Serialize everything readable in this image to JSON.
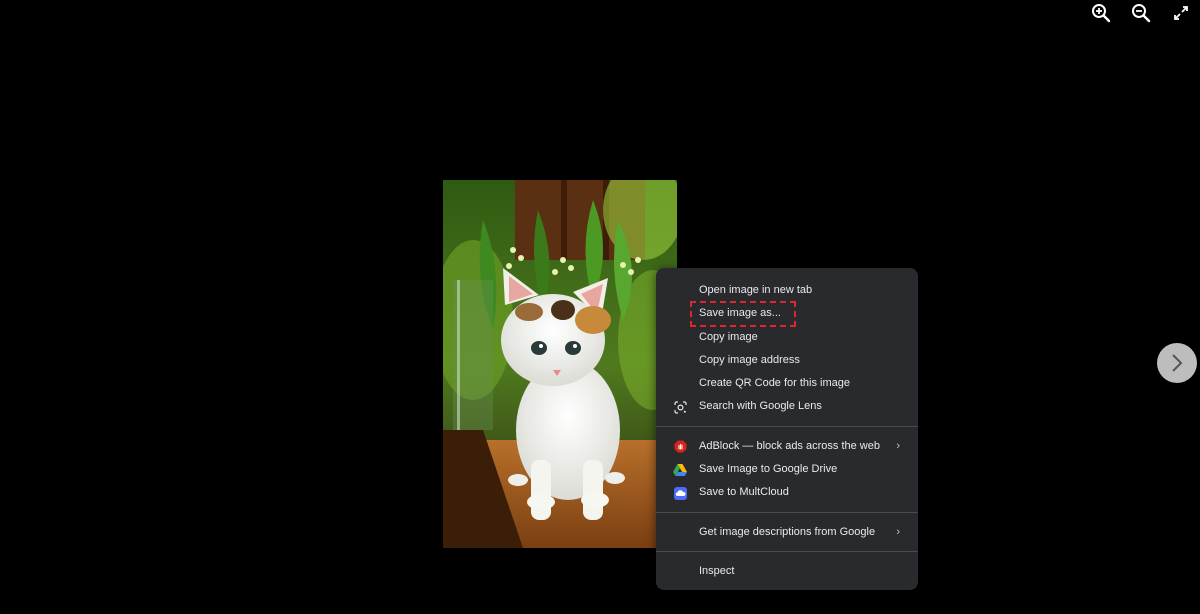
{
  "toolbar": {
    "zoom_in_icon": "zoom-in-icon",
    "zoom_out_icon": "zoom-out-icon",
    "fullscreen_icon": "expand-icon"
  },
  "image": {
    "subject": "kitten-photo"
  },
  "context_menu": {
    "group1": [
      {
        "label": "Open image in new tab"
      },
      {
        "label": "Save image as..."
      },
      {
        "label": "Copy image"
      },
      {
        "label": "Copy image address"
      },
      {
        "label": "Create QR Code for this image"
      },
      {
        "label": "Search with Google Lens",
        "icon": "google-lens-icon"
      }
    ],
    "group2": [
      {
        "label": "AdBlock — block ads across the web",
        "icon": "adblock-icon",
        "submenu": "›"
      },
      {
        "label": "Save Image to Google Drive",
        "icon": "google-drive-icon"
      },
      {
        "label": "Save to MultCloud",
        "icon": "multcloud-icon"
      }
    ],
    "group3": [
      {
        "label": "Get image descriptions from Google",
        "submenu": "›"
      }
    ],
    "group4": [
      {
        "label": "Inspect"
      }
    ]
  },
  "colors": {
    "menu_bg": "#292a2d",
    "menu_text": "#e8eaed",
    "highlight": "#e0262d",
    "adblock_red": "#d9241c",
    "multcloud_blue": "#4a6cf7"
  }
}
